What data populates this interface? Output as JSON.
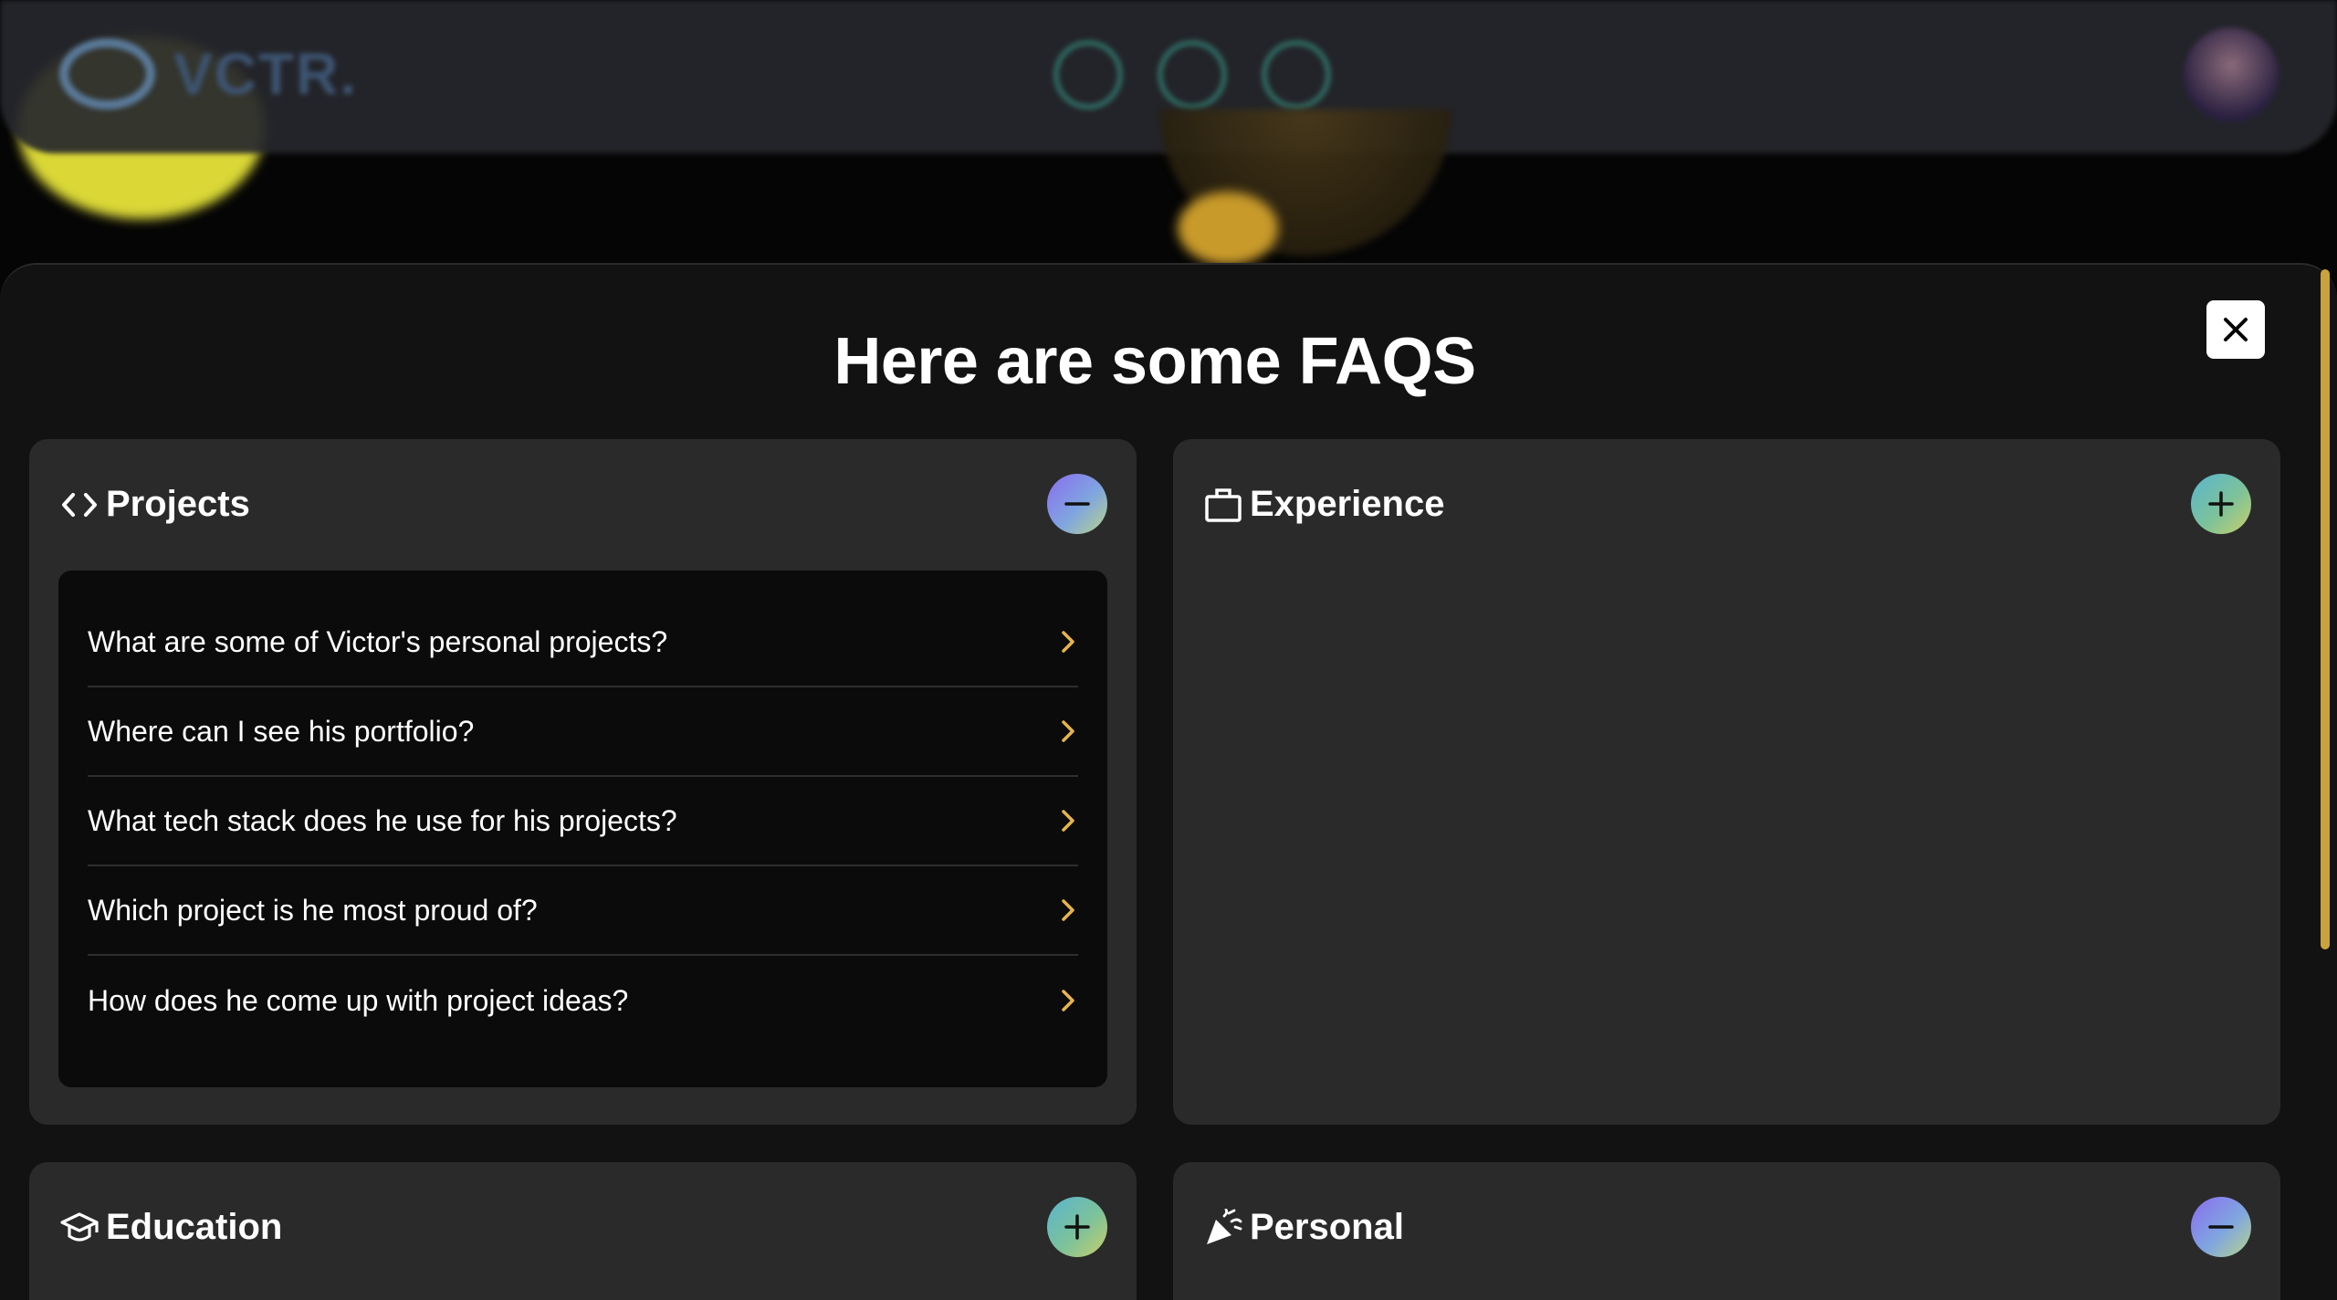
{
  "nav": {
    "logo_text": "VCTR."
  },
  "modal": {
    "title": "Here are some FAQS"
  },
  "sections": {
    "projects": {
      "title": "Projects",
      "icon": "code-icon",
      "state": "expanded",
      "questions": [
        "What are some of Victor's personal projects?",
        "Where can I see his portfolio?",
        "What tech stack does he use for his projects?",
        "Which project is he most proud of?",
        "How does he come up with project ideas?"
      ]
    },
    "experience": {
      "title": "Experience",
      "icon": "briefcase-icon",
      "state": "collapsed"
    },
    "education": {
      "title": "Education",
      "icon": "graduation-cap-icon",
      "state": "collapsed"
    },
    "personal": {
      "title": "Personal",
      "icon": "party-popper-icon",
      "state": "expanded"
    }
  },
  "colors": {
    "accent_chevron": "#e8b54a",
    "card_bg": "#2a2a2a",
    "panel_bg": "#0b0b0b",
    "scrollbar": "#c9a23e"
  }
}
